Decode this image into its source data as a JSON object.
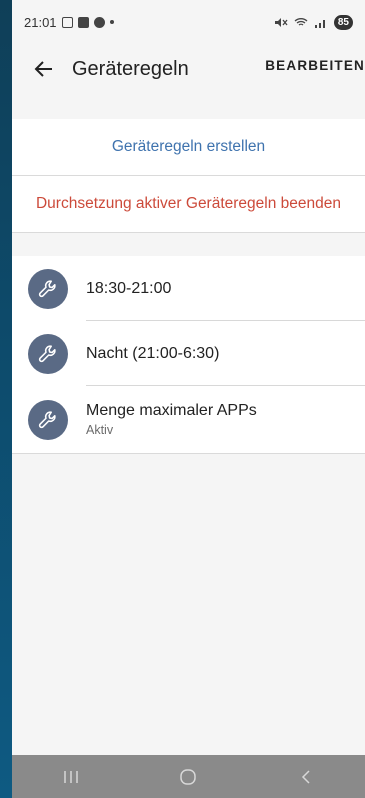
{
  "status_bar": {
    "time": "21:01",
    "battery": "85"
  },
  "app_bar": {
    "title": "Geräteregeln",
    "edit_label": "BEARBEITEN"
  },
  "actions": {
    "create_label": "Geräteregeln erstellen",
    "stop_label": "Durchsetzung aktiver Geräteregeln beenden"
  },
  "rules": [
    {
      "title": "18:30-21:00",
      "subtitle": ""
    },
    {
      "title": "Nacht (21:00-6:30)",
      "subtitle": ""
    },
    {
      "title": "Menge maximaler APPs",
      "subtitle": "Aktiv"
    }
  ],
  "colors": {
    "create": "#3f73ae",
    "stop": "#cc4a3a",
    "rule_icon_bg": "#5a6a85"
  }
}
